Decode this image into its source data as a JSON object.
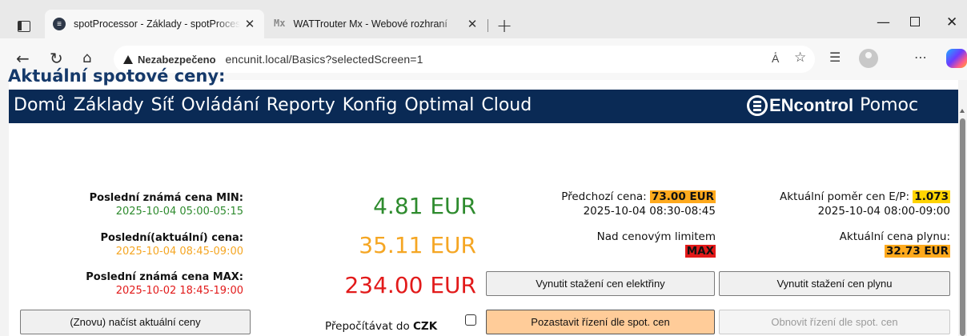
{
  "browser": {
    "tabs": [
      {
        "title": "spotProcessor - Základy - spotProcessor",
        "favicon": "encontrol-logo",
        "active": true
      },
      {
        "title": "WATTrouter Mx - Webové rozhraní",
        "favicon": "mx-logo",
        "active": false
      }
    ],
    "security_label": "Nezabezpečeno",
    "url": "encunit.local/Basics?selectedScreen=1",
    "icons": [
      "back-icon",
      "reload-icon",
      "home-icon",
      "read-aloud-icon",
      "favorite-icon",
      "favorites-icon",
      "profile-icon",
      "more-icon",
      "copilot-icon"
    ]
  },
  "nav": {
    "items": [
      "Domů",
      "Základy",
      "Síť",
      "Ovládání",
      "Reporty",
      "Konfig",
      "Optimal",
      "Cloud"
    ],
    "brand": "ENcontrol",
    "help": "Pomoc"
  },
  "heading": "Aktuální spotové ceny:",
  "prices": {
    "min": {
      "label": "Poslední známá cena MIN:",
      "time": "2025-10-04 05:00-05:15",
      "value": "4.81 EUR"
    },
    "current": {
      "label": "Poslední(aktuální) cena:",
      "time": "2025-10-04 08:45-09:00",
      "value": "35.11 EUR"
    },
    "max": {
      "label": "Poslední známá cena MAX:",
      "time": "2025-10-02 18:45-19:00",
      "value": "234.00 EUR"
    }
  },
  "previous": {
    "label": "Předchozí cena:",
    "value": "73.00 EUR",
    "time": "2025-10-04 08:30-08:45"
  },
  "limit": {
    "label": "Nad cenovým limitem",
    "badge": "MAX"
  },
  "ratio": {
    "label": "Aktuální poměr cen E/P:",
    "value": "1.073",
    "time": "2025-10-04 08:00-09:00"
  },
  "gas": {
    "label": "Aktuální cena plynu:",
    "value": "32.73 EUR"
  },
  "buttons": {
    "reload": "(Znovu) načíst aktuální ceny",
    "force_electricity": "Vynutit stažení cen elektřiny",
    "force_gas": "Vynutit stažení cen plynu",
    "pause": "Pozastavit řízení dle spot. cen",
    "resume": "Obnovit řízení dle spot. cen"
  },
  "recalc": {
    "label": "Přepočítávat do",
    "currency": "CZK"
  },
  "colors": {
    "navbar": "#0a2a55",
    "heading": "#15396a",
    "min": "#2e8b2e",
    "current": "#f5a623",
    "max": "#e21a1a",
    "highlight_orange": "#ffaa1d",
    "highlight_yellow": "#ffd400",
    "highlight_red": "#e21a1a",
    "pause_button": "#ffcc99"
  }
}
